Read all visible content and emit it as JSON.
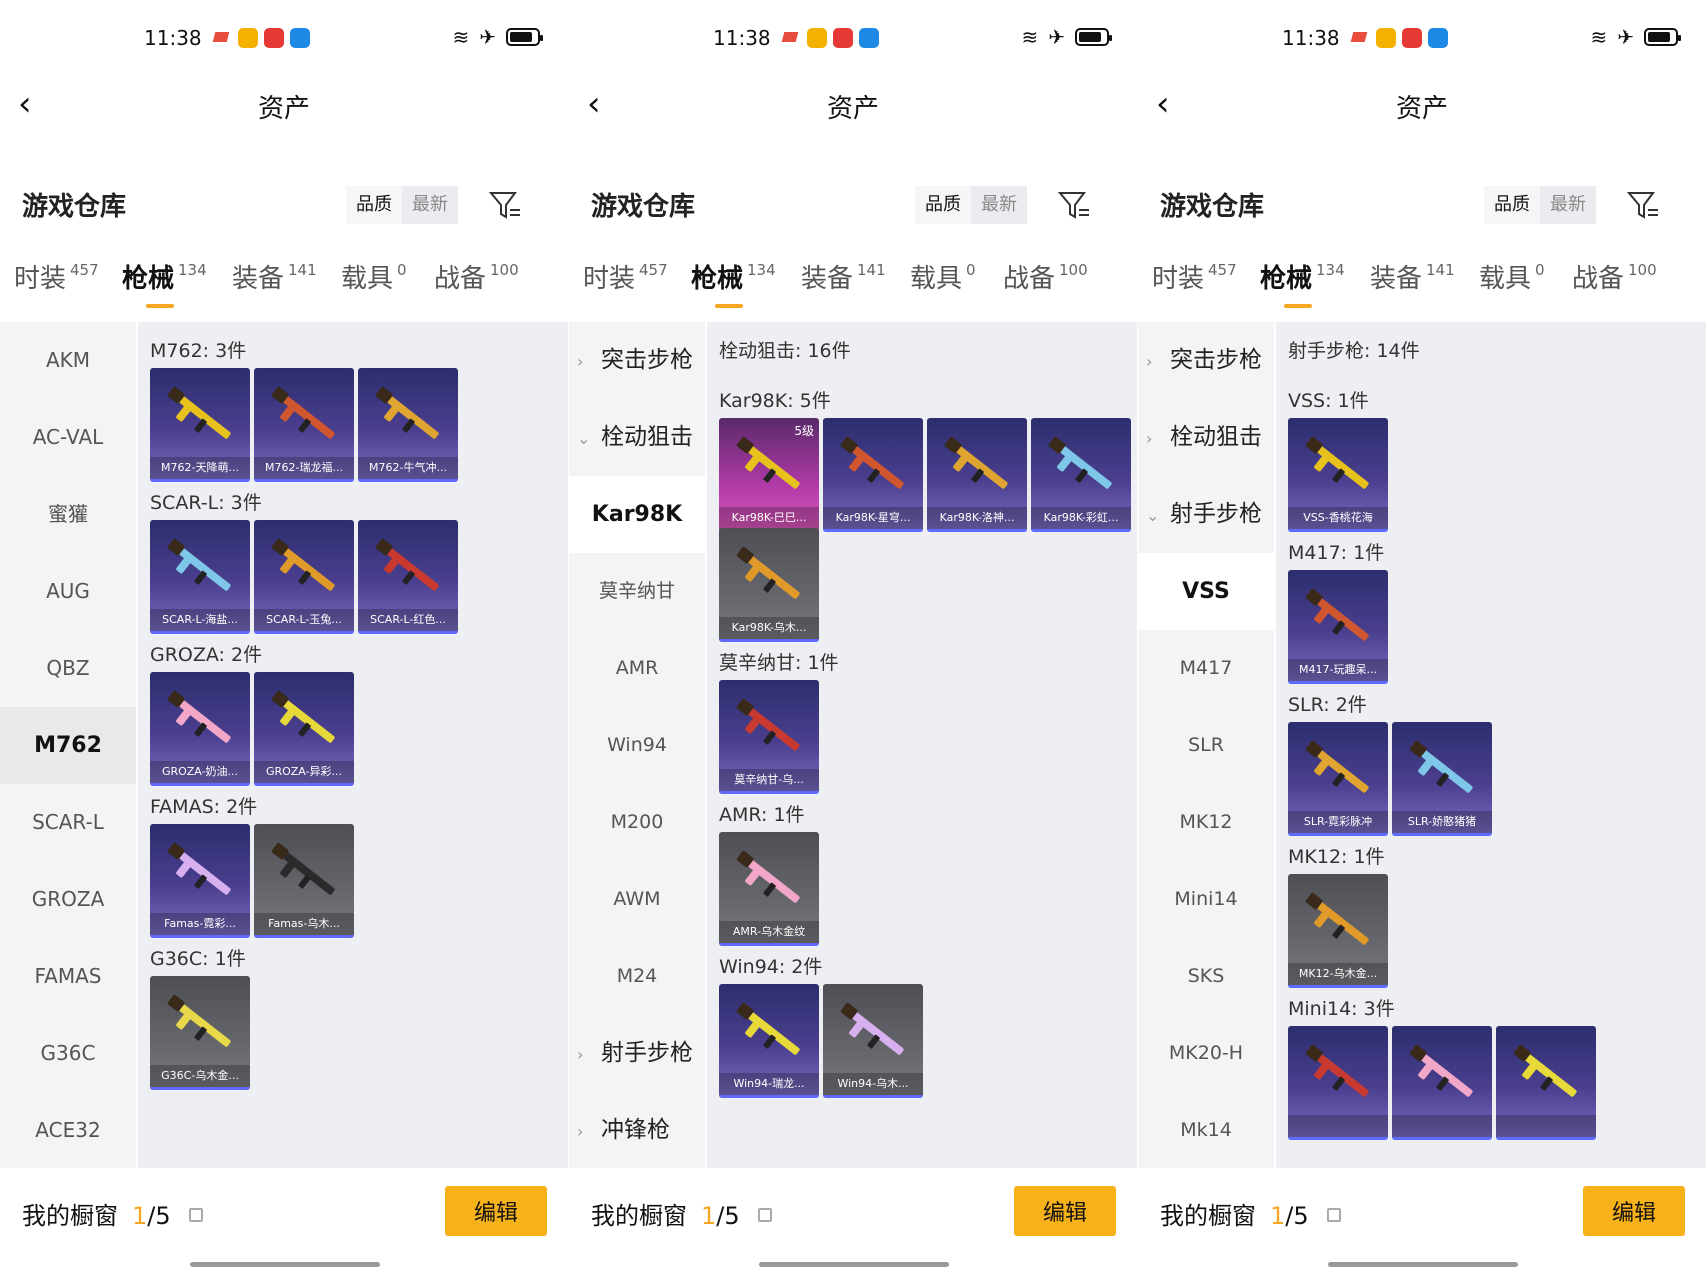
{
  "status": {
    "time": "11:38"
  },
  "header": {
    "title": "资产",
    "back_icon": "chevron-left-icon"
  },
  "warehouse": {
    "title": "游戏仓库",
    "sort_quality": "品质",
    "sort_latest": "最新",
    "filter_icon": "filter-icon"
  },
  "tabs": [
    {
      "label": "时装",
      "count": "457"
    },
    {
      "label": "枪械",
      "count": "134"
    },
    {
      "label": "装备",
      "count": "141"
    },
    {
      "label": "载具",
      "count": "0"
    },
    {
      "label": "战备",
      "count": "100"
    }
  ],
  "active_tab": "枪械",
  "showcase": {
    "label": "我的橱窗",
    "current": "1",
    "total": "/5",
    "edit_label": "编辑"
  },
  "colors": {
    "accent": "#f5a623",
    "share_button": "#f7b21a",
    "card_purple": "#4b3f8f",
    "card_grey": "#65676d"
  },
  "panel1": {
    "sidebar": [
      "AKM",
      "AC-VAL",
      "蜜獾",
      "AUG",
      "QBZ",
      "M762",
      "SCAR-L",
      "GROZA",
      "FAMAS",
      "G36C",
      "ACE32"
    ],
    "sidebar_selected": "M762",
    "sections": [
      {
        "title": "M762: 3件",
        "items": [
          "M762-天降萌...",
          "M762-瑞龙福...",
          "M762-牛气冲..."
        ]
      },
      {
        "title": "SCAR-L: 3件",
        "items": [
          "SCAR-L-海盐...",
          "SCAR-L-玉兔...",
          "SCAR-L-红色..."
        ]
      },
      {
        "title": "GROZA: 2件",
        "items": [
          "GROZA-奶油...",
          "GROZA-异彩..."
        ]
      },
      {
        "title": "FAMAS: 2件",
        "items": [
          "Famas-霓彩...",
          "Famas-乌木..."
        ]
      },
      {
        "title": "G36C: 1件",
        "items": [
          "G36C-乌木金..."
        ]
      }
    ]
  },
  "panel2": {
    "sidebar_categories": [
      "突击步枪",
      "栓动狙击",
      "射手步枪",
      "冲锋枪"
    ],
    "sidebar_leaves": [
      "Kar98K",
      "莫辛纳甘",
      "AMR",
      "Win94",
      "M200",
      "AWM",
      "M24"
    ],
    "sidebar_selected": "Kar98K",
    "group_title": "栓动狙击: 16件",
    "sections": [
      {
        "title": "Kar98K: 5件",
        "items": [
          "Kar98K-巳巳...",
          "Kar98K-星穹...",
          "Kar98K-洛神...",
          "Kar98K-彩虹...",
          "Kar98K-乌木..."
        ],
        "first_level": "5级"
      },
      {
        "title": "莫辛纳甘: 1件",
        "items": [
          "莫辛纳甘-乌..."
        ]
      },
      {
        "title": "AMR: 1件",
        "items": [
          "AMR-乌木金纹"
        ]
      },
      {
        "title": "Win94: 2件",
        "items": [
          "Win94-瑞龙...",
          "Win94-乌木..."
        ]
      }
    ]
  },
  "panel3": {
    "sidebar_categories": [
      "突击步枪",
      "栓动狙击",
      "射手步枪"
    ],
    "sidebar_leaves": [
      "VSS",
      "M417",
      "SLR",
      "MK12",
      "Mini14",
      "SKS",
      "MK20-H",
      "Mk14"
    ],
    "sidebar_selected": "VSS",
    "group_title": "射手步枪: 14件",
    "sections": [
      {
        "title": "VSS: 1件",
        "items": [
          "VSS-香桃花海"
        ]
      },
      {
        "title": "M417: 1件",
        "items": [
          "M417-玩趣呆..."
        ]
      },
      {
        "title": "SLR: 2件",
        "items": [
          "SLR-霓彩脉冲",
          "SLR-娇憨猪猪"
        ]
      },
      {
        "title": "MK12: 1件",
        "items": [
          "MK12-乌木金..."
        ]
      },
      {
        "title": "Mini14: 3件",
        "items": [
          "",
          "",
          ""
        ]
      }
    ]
  }
}
